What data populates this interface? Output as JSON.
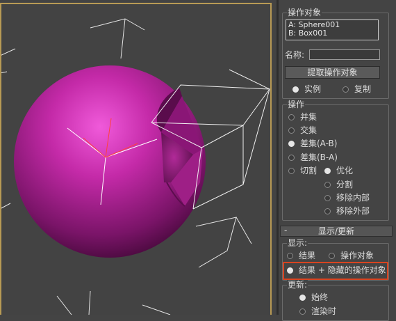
{
  "operands": {
    "title": "操作对象",
    "list": [
      "A: Sphere001",
      "B: Box001"
    ],
    "name_label": "名称:",
    "name_value": "",
    "extract_button": "提取操作对象",
    "copy_modes": [
      {
        "label": "实例",
        "selected": true
      },
      {
        "label": "复制",
        "selected": false
      }
    ]
  },
  "operation": {
    "title": "操作",
    "items": [
      {
        "label": "并集",
        "selected": false
      },
      {
        "label": "交集",
        "selected": false
      },
      {
        "label": "差集(A-B)",
        "selected": true
      },
      {
        "label": "差集(B-A)",
        "selected": false
      },
      {
        "label": "切割",
        "selected": false
      }
    ],
    "cut_options": [
      {
        "label": "优化",
        "selected": true
      },
      {
        "label": "分割",
        "selected": false
      },
      {
        "label": "移除内部",
        "selected": false
      },
      {
        "label": "移除外部",
        "selected": false
      }
    ]
  },
  "display_rollout": {
    "toggle": "-",
    "title": "显示/更新",
    "display_group": {
      "title": "显示:",
      "options": [
        {
          "label": "结果",
          "selected": false
        },
        {
          "label": "操作对象",
          "selected": false
        },
        {
          "label": "结果 + 隐藏的操作对象",
          "selected": true
        }
      ]
    },
    "update_group": {
      "title": "更新:",
      "options": [
        {
          "label": "始终",
          "selected": true
        },
        {
          "label": "渲染时",
          "selected": false
        }
      ]
    }
  },
  "colors": {
    "viewport_border": "#b89a55",
    "sphere": "#b0229a",
    "highlight": "#d94420"
  }
}
